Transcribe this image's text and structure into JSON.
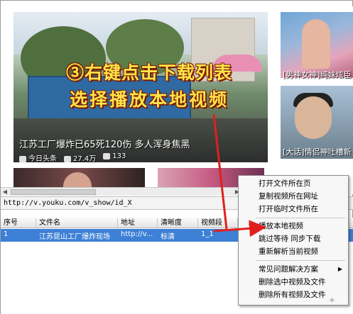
{
  "web": {
    "caption_line1": "③右键点击下载列表",
    "caption_line2": "选择播放本地视频",
    "main_title": "江苏工厂爆炸已65死120伤 多人浑身焦黑",
    "meta_source": "今日头条",
    "meta_views": "27.4万",
    "meta_comments": "133",
    "side1_caption": "[男神女神]纯妹炫臣",
    "side2_caption": "[大话]情侣神吐槽新"
  },
  "urlbar": {
    "url": "http://v.youku.com/v_show/id_X"
  },
  "table": {
    "headers": [
      "序号",
      "文件名",
      "地址",
      "清晰度",
      "视频段"
    ],
    "rows": [
      {
        "index": "1",
        "filename": "江苏昆山工厂爆炸现场",
        "url": "http://v...",
        "quality": "标清",
        "segment": "1_1"
      }
    ]
  },
  "context_menu": {
    "items": [
      "打开文件所在页",
      "复制视频所在网址",
      "打开临时文件所在",
      "播放本地视频",
      "跳过等待  同步下载",
      "重新解析当前视频",
      "常见问题解决方案",
      "删除选中视频及文件",
      "删除所有视频及文件"
    ],
    "checked_marker": "◆",
    "submenu_arrow": "▶"
  },
  "colors": {
    "selection": "#3d80d5",
    "arrow": "#e0201d",
    "caption": "#ffe44a"
  }
}
